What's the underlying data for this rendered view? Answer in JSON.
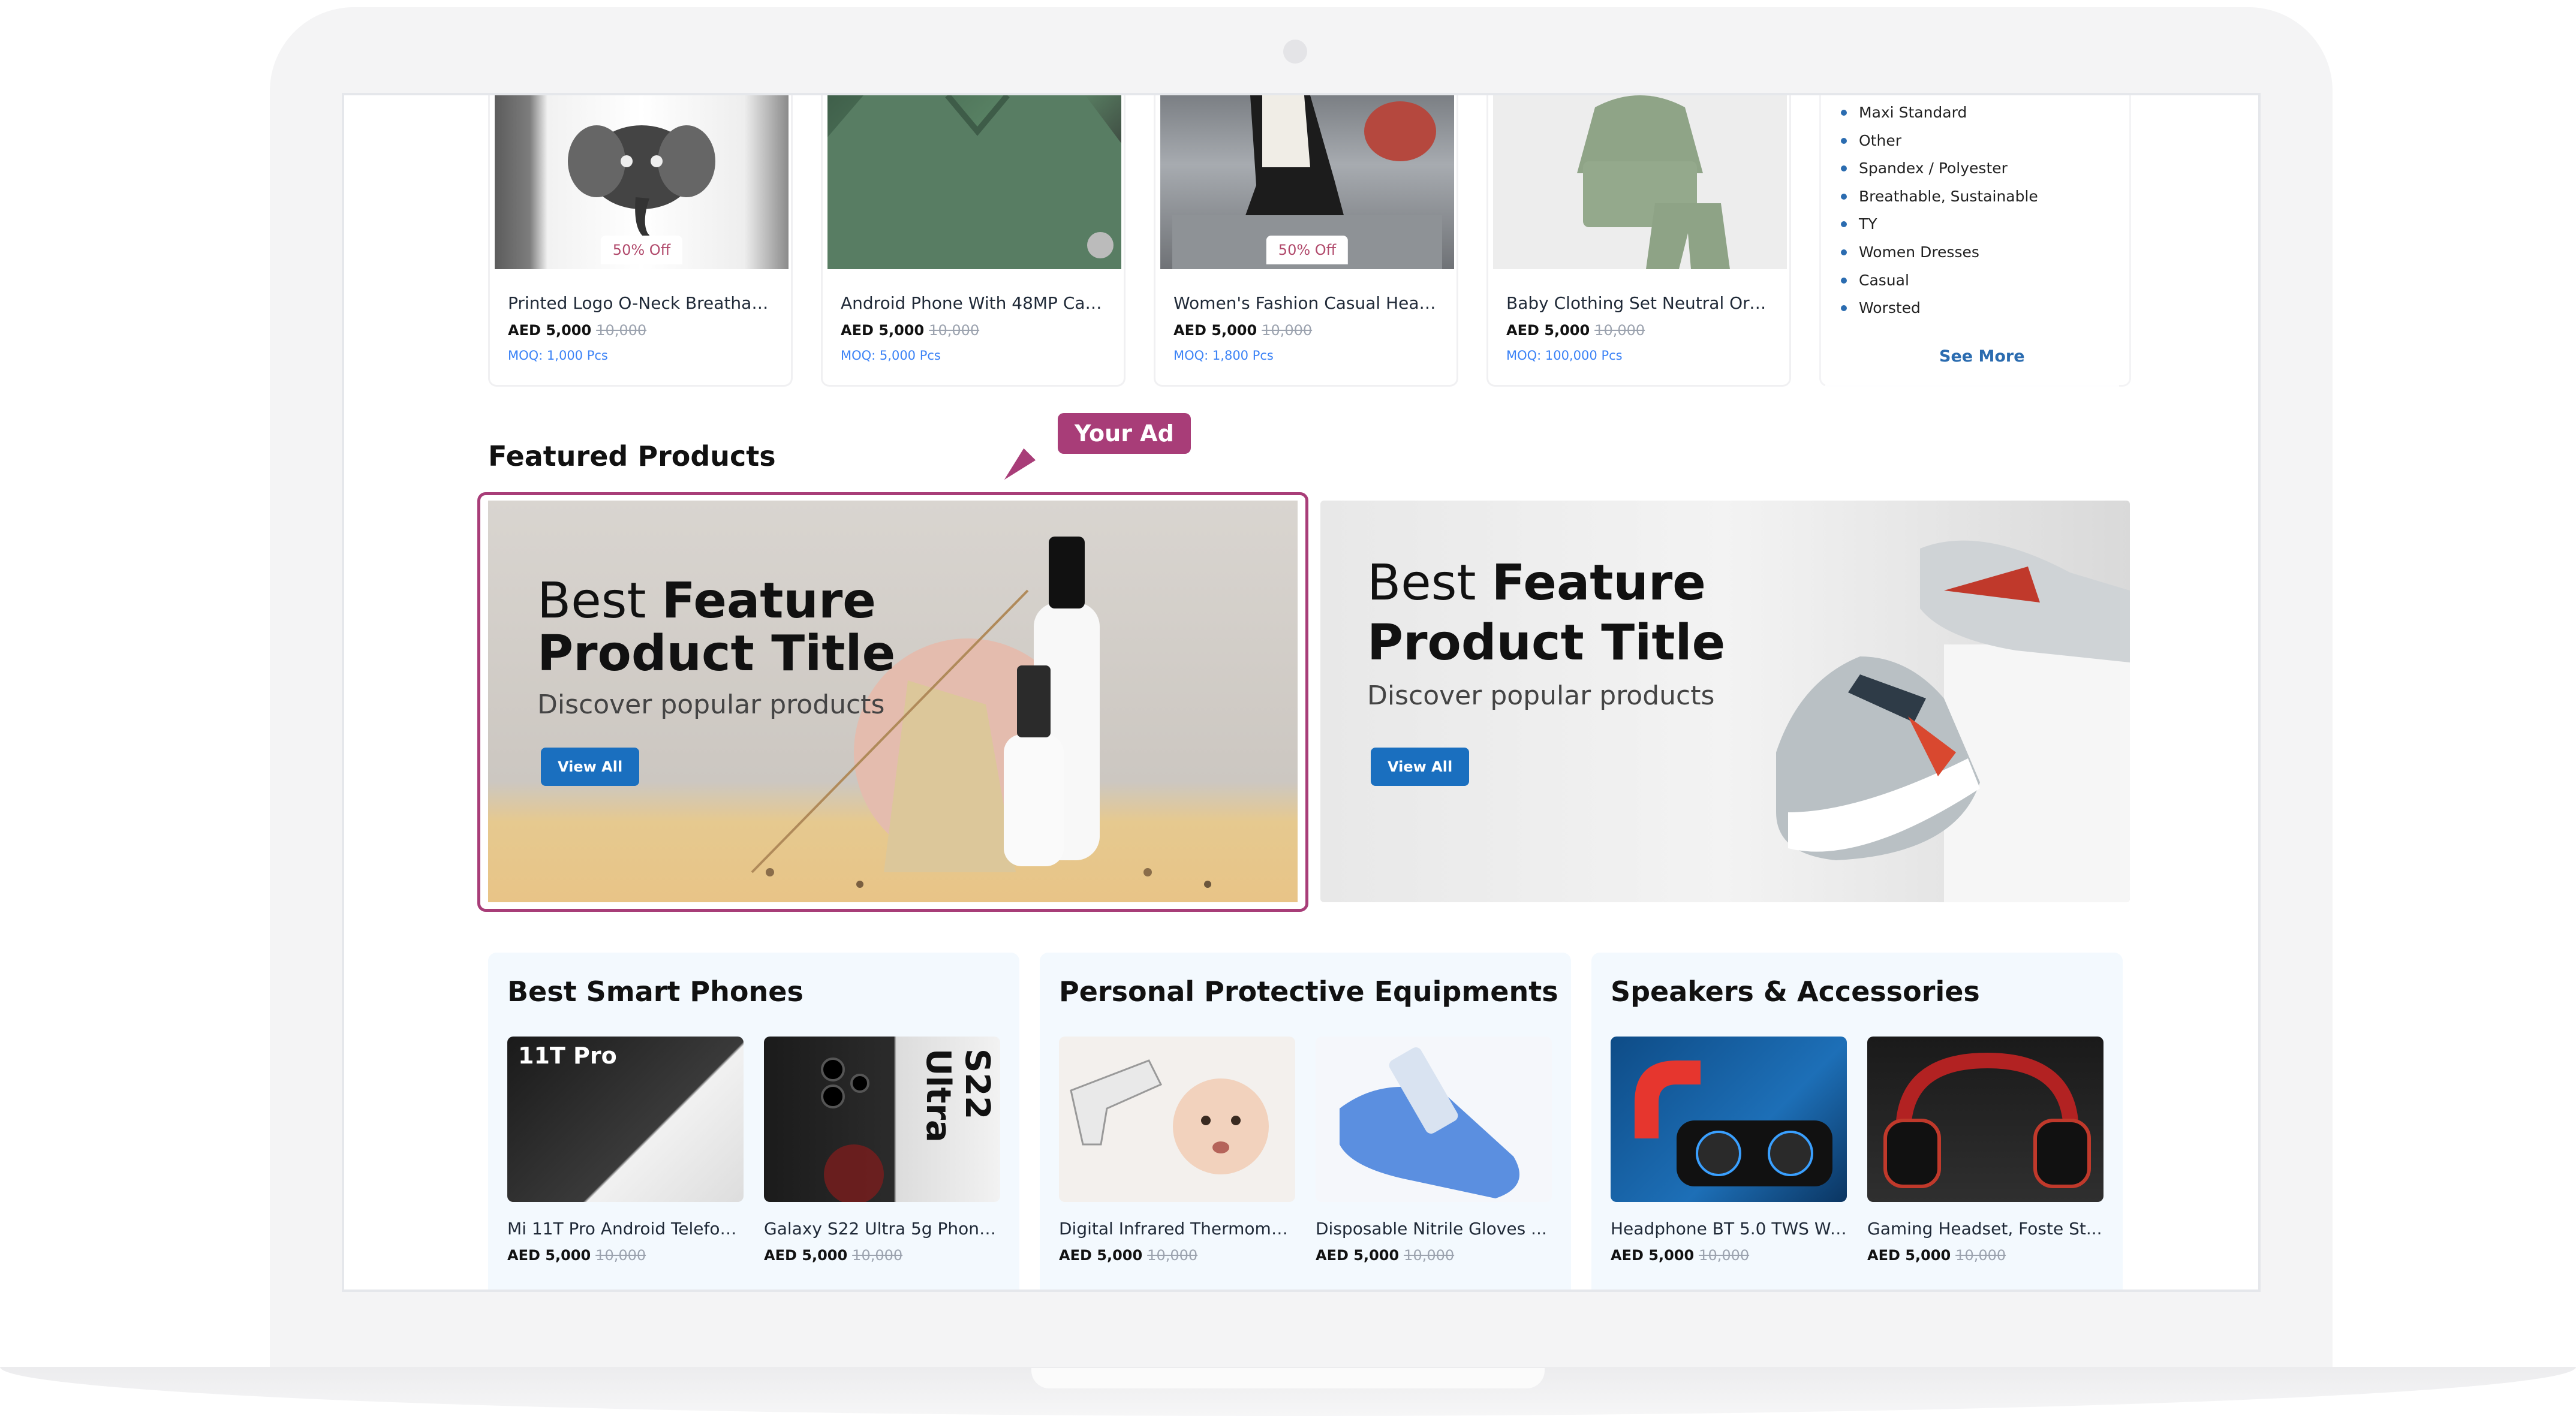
{
  "top_cards": [
    {
      "title": "Printed Logo O-Neck Breathabl...",
      "price": "AED 5,000",
      "old_price": "10,000",
      "moq": "MOQ: 1,000 Pcs",
      "badge": "50% Off"
    },
    {
      "title": "Android Phone With 48MP Cam...",
      "price": "AED 5,000",
      "old_price": "10,000",
      "moq": "MOQ: 5,000 Pcs",
      "badge": ""
    },
    {
      "title": "Women's Fashion Casual Heav...",
      "price": "AED 5,000",
      "old_price": "10,000",
      "moq": "MOQ: 1,800 Pcs",
      "badge": "50% Off"
    },
    {
      "title": "Baby Clothing Set Neutral Orga...",
      "price": "AED 5,000",
      "old_price": "10,000",
      "moq": "MOQ: 100,000 Pcs",
      "badge": ""
    }
  ],
  "material_filter": {
    "items": [
      "Maxi Standard",
      "Other",
      "Spandex / Polyester",
      "Breathable, Sustainable",
      "TY",
      "Women Dresses",
      "Casual",
      "Worsted"
    ],
    "see_more": "See More"
  },
  "featured": {
    "title": "Featured Products",
    "ad_callout": "Your Ad",
    "banners": [
      {
        "line1_light": "Best ",
        "line1_bold": "Feature",
        "line2": "Product Title",
        "subtitle": "Discover popular products",
        "button": "View All"
      },
      {
        "line1_light": "Best ",
        "line1_bold": "Feature",
        "line2": "Product Title",
        "subtitle": "Discover popular products",
        "button": "View All"
      }
    ]
  },
  "panels": [
    {
      "title": "Best Smart Phones",
      "items": [
        {
          "title": "Mi 11T Pro Android Telefonic...",
          "price": "AED 5,000",
          "old_price": "10,000",
          "img_text": "11T Pro"
        },
        {
          "title": "Galaxy S22 Ultra 5g Phone...",
          "price": "AED 5,000",
          "old_price": "10,000",
          "img_text": "S22 Ultra"
        }
      ]
    },
    {
      "title": "Personal Protective Equipments",
      "items": [
        {
          "title": "Digital Infrared Thermomet...",
          "price": "AED 5,000",
          "old_price": "10,000"
        },
        {
          "title": "Disposable Nitrile Gloves ...",
          "price": "AED 5,000",
          "old_price": "10,000"
        }
      ]
    },
    {
      "title": "Speakers & Accessories",
      "items": [
        {
          "title": "Headphone BT 5.0 TWS Wa...",
          "price": "AED 5,000",
          "old_price": "10,000"
        },
        {
          "title": "Gaming Headset, Foste St...",
          "price": "AED 5,000",
          "old_price": "10,000"
        }
      ]
    }
  ],
  "colors": {
    "accent": "#a83d78",
    "link": "#2b6cb0",
    "button": "#1a6fbf"
  }
}
